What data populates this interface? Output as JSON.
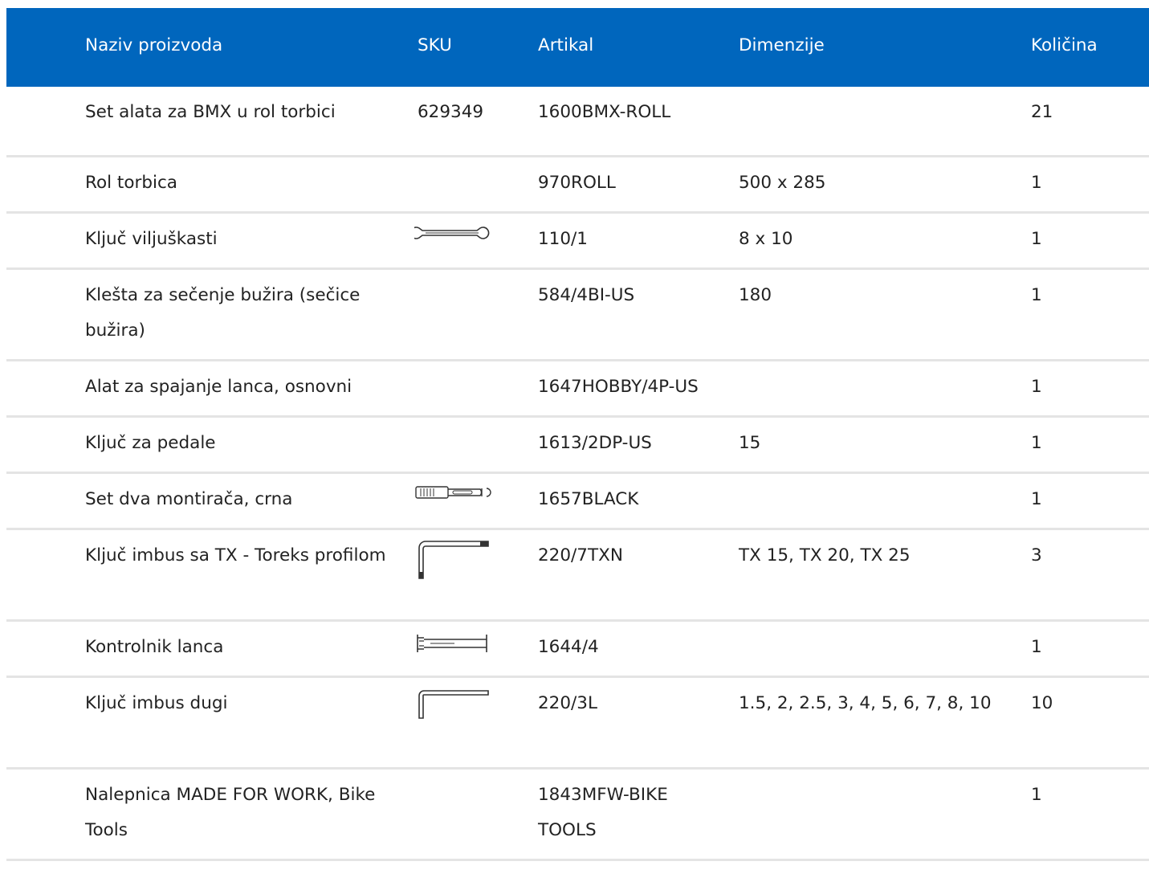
{
  "table": {
    "headers": {
      "name": "Naziv proizvoda",
      "sku": "SKU",
      "article": "Artikal",
      "dimensions": "Dimenzije",
      "quantity": "Količina"
    },
    "rows": [
      {
        "name": "Set alata za BMX u rol torbici",
        "sku": "629349",
        "article": "1600BMX-ROLL",
        "dimensions": "",
        "quantity": "21",
        "icon": ""
      },
      {
        "name": "Rol torbica",
        "sku": "",
        "article": "970ROLL",
        "dimensions": "500 x 285",
        "quantity": "1",
        "icon": ""
      },
      {
        "name": "Ključ viljuškasti",
        "sku": "",
        "article": "110/1",
        "dimensions": "8 x 10",
        "quantity": "1",
        "icon": "open-end-wrench-icon"
      },
      {
        "name": "Klešta za sečenje bužira (sečice bužira)",
        "sku": "",
        "article": "584/4BI-US",
        "dimensions": "180",
        "quantity": "1",
        "icon": ""
      },
      {
        "name": "Alat za spajanje lanca, osnovni",
        "sku": "",
        "article": "1647HOBBY/4P-US",
        "dimensions": "",
        "quantity": "1",
        "icon": ""
      },
      {
        "name": "Ključ za pedale",
        "sku": "",
        "article": "1613/2DP-US",
        "dimensions": "15",
        "quantity": "1",
        "icon": ""
      },
      {
        "name": "Set dva montirača, crna",
        "sku": "",
        "article": "1657BLACK",
        "dimensions": "",
        "quantity": "1",
        "icon": "tire-lever-icon"
      },
      {
        "name": "Ključ imbus sa TX - Toreks profilom",
        "sku": "",
        "article": "220/7TXN",
        "dimensions": "TX 15, TX 20, TX 25",
        "quantity": "3",
        "icon": "torx-key-icon"
      },
      {
        "name": "Kontrolnik lanca",
        "sku": "",
        "article": "1644/4",
        "dimensions": "",
        "quantity": "1",
        "icon": "chain-checker-icon"
      },
      {
        "name": "Ključ imbus dugi",
        "sku": "",
        "article": "220/3L",
        "dimensions": "1.5, 2, 2.5, 3, 4, 5, 6, 7, 8, 10",
        "quantity": "10",
        "icon": "hex-key-icon"
      },
      {
        "name": "Nalepnica MADE FOR WORK, Bike Tools",
        "sku": "",
        "article": "1843MFW-BIKE TOOLS",
        "dimensions": "",
        "quantity": "1",
        "icon": ""
      }
    ]
  }
}
